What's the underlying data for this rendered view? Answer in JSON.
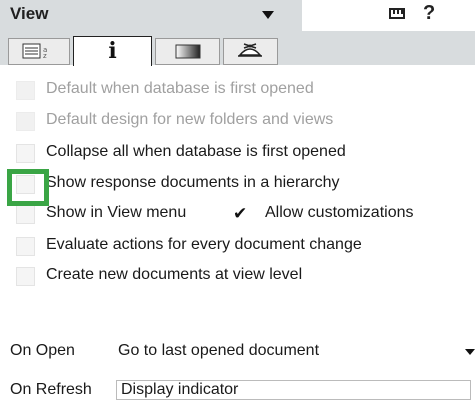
{
  "title": {
    "label": "View"
  },
  "tabs": [
    {
      "name": "info",
      "glyph": "i"
    },
    {
      "name": "basics"
    },
    {
      "name": "style"
    },
    {
      "name": "advanced"
    }
  ],
  "options": [
    {
      "label": "Default when database is first opened",
      "checked": false,
      "enabled": false
    },
    {
      "label": "Default design for new folders and views",
      "checked": false,
      "enabled": false
    },
    {
      "label": "Collapse all when database is first opened",
      "checked": false,
      "enabled": true
    },
    {
      "label": "Show response documents in a hierarchy",
      "checked": false,
      "enabled": true
    },
    {
      "label": "Show in View menu",
      "checked": false,
      "enabled": true
    },
    {
      "label": "Allow customizations",
      "checked": true,
      "enabled": true
    },
    {
      "label": "Evaluate actions for every document change",
      "checked": false,
      "enabled": true
    },
    {
      "label": "Create new documents at view level",
      "checked": false,
      "enabled": true
    }
  ],
  "on_open": {
    "label": "On Open",
    "value": "Go to last opened document"
  },
  "on_refresh": {
    "label": "On Refresh",
    "value": "Display indicator"
  },
  "icons": {
    "help": "?"
  },
  "colors": {
    "highlight": "#3aa545",
    "header_bg": "#d8dcde"
  }
}
